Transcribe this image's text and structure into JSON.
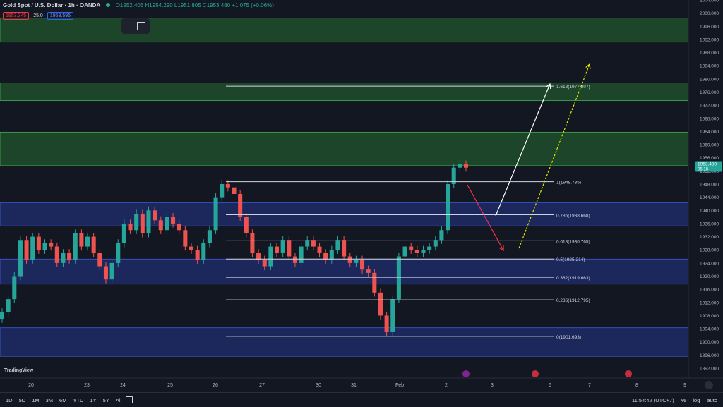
{
  "header": {
    "symbol": "Gold Spot / U.S. Dollar · 1h · OANDA",
    "ohlc": "O1952.405  H1954.290  L1951.805  C1953.480  +1.075 (+0.06%)"
  },
  "trade": {
    "sell_price": "1953.345",
    "spread": "25.0",
    "buy_price": "1953.595"
  },
  "colors": {
    "bg": "#131722",
    "up": "#26a69a",
    "down": "#ef5350",
    "green_zone": "#1f4d2a",
    "blue_zone": "#1e2a66"
  },
  "chart_data": {
    "type": "candlestick",
    "y_axis": {
      "range": [
        1889,
        2004
      ],
      "ticks": [
        "2004.000",
        "2000.000",
        "1996.000",
        "1992.000",
        "1988.000",
        "1984.000",
        "1980.000",
        "1976.000",
        "1972.000",
        "1968.000",
        "1964.000",
        "1960.000",
        "1956.000",
        "1952.000",
        "1948.000",
        "1944.000",
        "1940.000",
        "1936.000",
        "1932.000",
        "1928.000",
        "1924.000",
        "1920.000",
        "1916.000",
        "1912.000",
        "1908.000",
        "1904.000",
        "1900.000",
        "1896.000",
        "1892.000"
      ]
    },
    "x_axis": {
      "labels": [
        "20",
        "23",
        "24",
        "25",
        "26",
        "27",
        "30",
        "31",
        "Feb",
        "2",
        "3",
        "6",
        "7",
        "8",
        "9"
      ]
    },
    "current_price": {
      "value": "1953.480",
      "countdown": "05:18",
      "numeric": 1953.48
    },
    "zones": [
      {
        "kind": "supply",
        "low": 1991.2,
        "high": 1998.5
      },
      {
        "kind": "supply",
        "low": 1973.4,
        "high": 1978.8
      },
      {
        "kind": "supply",
        "low": 1953.6,
        "high": 1963.8
      },
      {
        "kind": "demand",
        "low": 1935.3,
        "high": 1942.3
      },
      {
        "kind": "demand",
        "low": 1917.6,
        "high": 1925.2
      },
      {
        "kind": "demand",
        "low": 1895.6,
        "high": 1904.3
      }
    ],
    "fibonacci": [
      {
        "label": "1.618(1977.807)",
        "price": 1977.807
      },
      {
        "label": "1(1948.735)",
        "price": 1948.735
      },
      {
        "label": "0.786(1938.668)",
        "price": 1938.668
      },
      {
        "label": "0.618(1930.765)",
        "price": 1930.765
      },
      {
        "label": "0.5(1925.214)",
        "price": 1925.214
      },
      {
        "label": "0.382(1919.663)",
        "price": 1919.663
      },
      {
        "label": "0.236(1912.795)",
        "price": 1912.795
      },
      {
        "label": "0(1901.693)",
        "price": 1901.693
      }
    ],
    "price_path": [
      1909,
      1913,
      1920,
      1931,
      1925,
      1932,
      1928,
      1930,
      1929,
      1924,
      1927,
      1925,
      1933,
      1929,
      1932,
      1927,
      1923,
      1919,
      1924,
      1930,
      1936,
      1934,
      1939,
      1933,
      1940,
      1937,
      1934,
      1938,
      1936,
      1934,
      1929,
      1928,
      1925,
      1930,
      1934,
      1944,
      1948,
      1947,
      1945,
      1938,
      1933,
      1927,
      1925,
      1923,
      1929,
      1927,
      1931,
      1926,
      1924,
      1929,
      1931,
      1929,
      1927,
      1925,
      1928,
      1931,
      1926,
      1924,
      1925,
      1922,
      1921,
      1915,
      1908,
      1903,
      1913,
      1926,
      1929,
      1928,
      1927,
      1928,
      1929,
      1931,
      1934,
      1948,
      1953,
      1954,
      1953
    ]
  },
  "ui": {
    "time_ranges": [
      "1D",
      "5D",
      "1M",
      "3M",
      "6M",
      "YTD",
      "1Y",
      "5Y",
      "All"
    ],
    "clock": "11:54:42 (UTC+7)",
    "scale_opts": [
      "%",
      "log",
      "auto"
    ],
    "logo": "TradingView"
  }
}
